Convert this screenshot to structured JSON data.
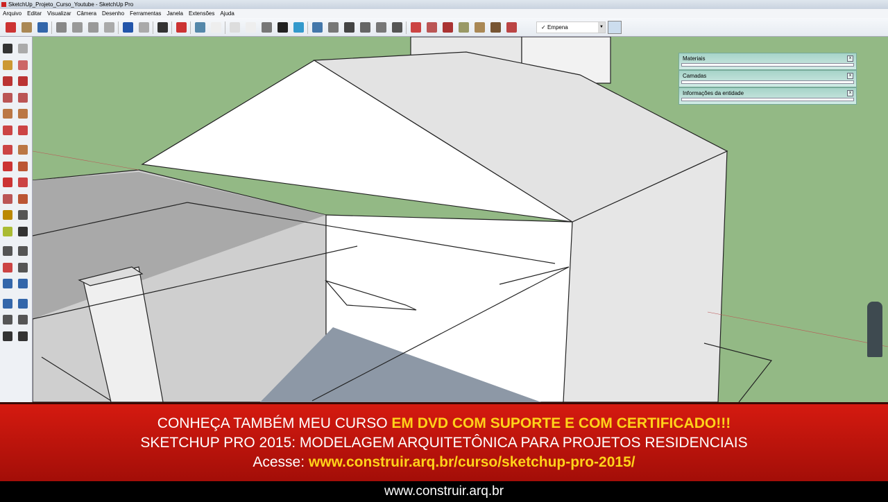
{
  "window": {
    "title": "SketchUp_Projeto_Curso_Youtube - SketchUp Pro"
  },
  "menu": [
    "Arquivo",
    "Editar",
    "Visualizar",
    "Câmera",
    "Desenho",
    "Ferramentas",
    "Janela",
    "Extensões",
    "Ajuda"
  ],
  "toolbar": {
    "icons": [
      "new-icon",
      "open-icon",
      "save-icon",
      "cut-icon",
      "copy-icon",
      "paste-icon",
      "erase-icon",
      "undo-icon",
      "redo-icon",
      "print-icon",
      "model-info-icon",
      "iso-view-icon",
      "top-view-icon",
      "xray-icon",
      "wireframe-icon",
      "hidden-line-icon",
      "shaded-icon",
      "shaded-texture-icon",
      "front-view-icon",
      "right-view-icon",
      "home-icon",
      "back-view-icon",
      "left-view-icon",
      "house-icon",
      "section-plane-icon",
      "section-display-icon",
      "styles-icon",
      "sandbox-icon",
      "terrain-icon",
      "stamp-icon",
      "flip-icon"
    ],
    "layer": {
      "check": "✓",
      "value": "Empena"
    }
  },
  "trays": [
    {
      "label": "Materiais"
    },
    {
      "label": "Camadas"
    },
    {
      "label": "Informações da entidade"
    }
  ],
  "banner": {
    "line1_a": "CONHEÇA TAMBÉM MEU CURSO ",
    "line1_b": "EM DVD COM SUPORTE E COM CERTIFICADO!!!",
    "line2": "SKETCHUP PRO 2015: MODELAGEM ARQUITETÔNICA PARA PROJETOS RESIDENCIAIS",
    "line3_a": "Acesse: ",
    "line3_b": "www.construir.arq.br/curso/sketchup-pro-2015/"
  },
  "footer": "www.construir.arq.br",
  "colors": {
    "ground": "#93b985",
    "banner": "#c4140c",
    "highlight": "#ffd21a"
  }
}
